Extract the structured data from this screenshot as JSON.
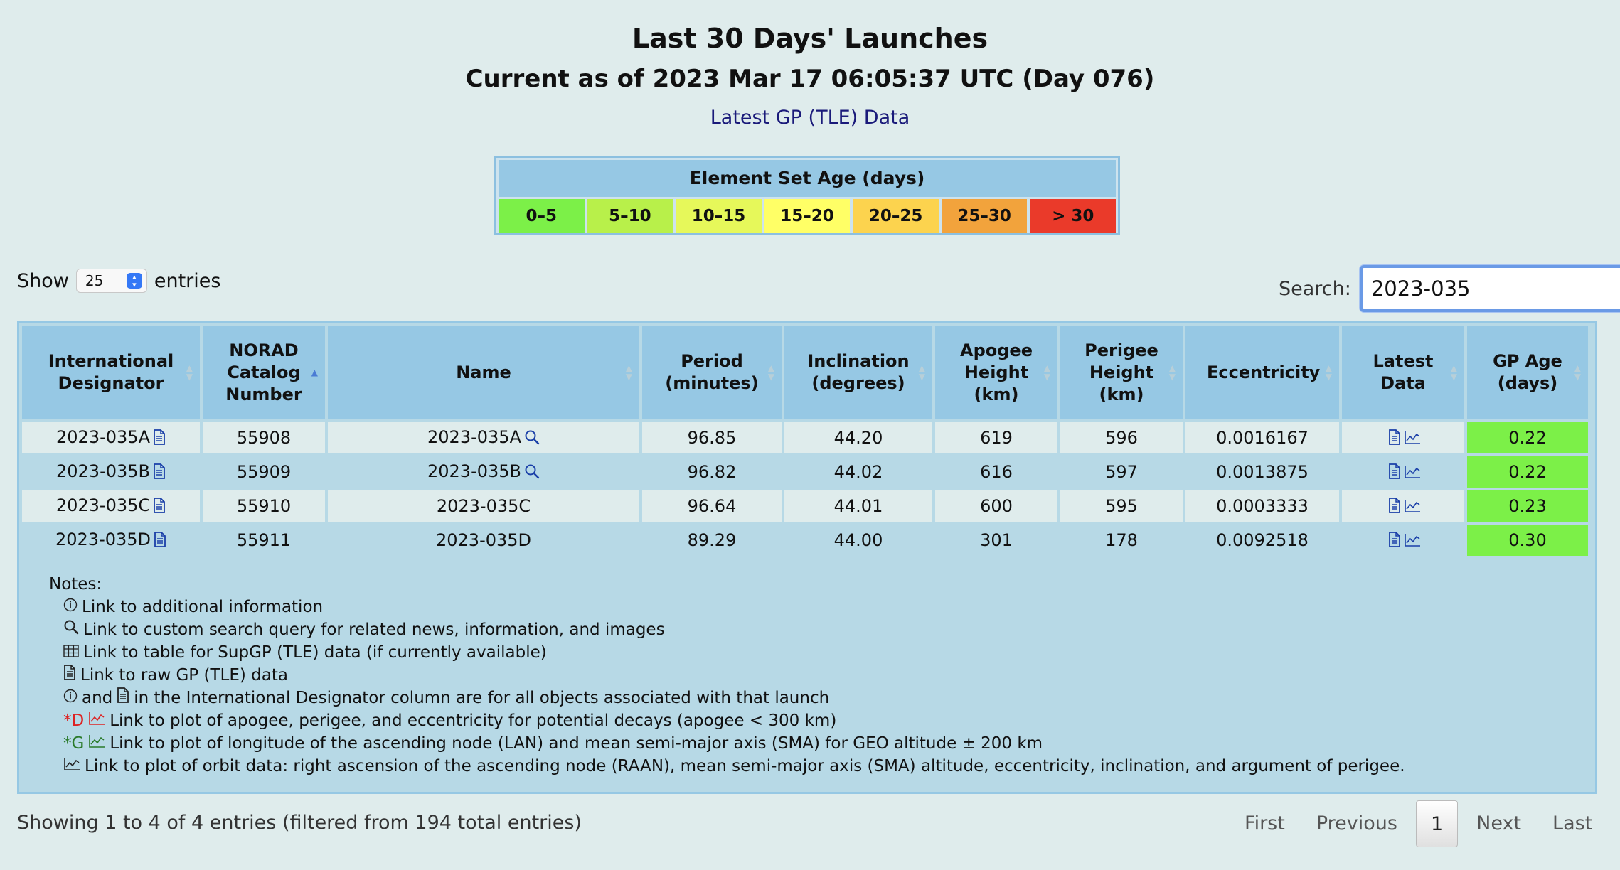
{
  "header": {
    "title": "Last 30 Days' Launches",
    "subtitle": "Current as of 2023 Mar 17 06:05:37 UTC (Day 076)",
    "gp_link": "Latest GP (TLE) Data"
  },
  "age_legend": {
    "title": "Element Set Age (days)",
    "buckets": [
      {
        "label": "0–5",
        "color": "#7cf048"
      },
      {
        "label": "5–10",
        "color": "#b8f04a"
      },
      {
        "label": "10–15",
        "color": "#e6f85a"
      },
      {
        "label": "15–20",
        "color": "#ffff66"
      },
      {
        "label": "20–25",
        "color": "#fcd34e"
      },
      {
        "label": "25–30",
        "color": "#f2a33c"
      },
      {
        "label": "> 30",
        "color": "#ea3a2a"
      }
    ]
  },
  "controls": {
    "show_label": "Show",
    "page_size": "25",
    "entries_label": "entries",
    "search_label": "Search:",
    "search_value": "2023-035"
  },
  "table": {
    "columns": [
      "International Designator",
      "NORAD Catalog Number",
      "Name",
      "Period (minutes)",
      "Inclination (degrees)",
      "Apogee Height (km)",
      "Perigee Height (km)",
      "Eccentricity",
      "Latest Data",
      "GP Age (days)"
    ],
    "rows": [
      {
        "intl": "2023-035A",
        "norad": "55908",
        "name": "2023-035A",
        "period": "96.85",
        "incl": "44.20",
        "apogee": "619",
        "perigee": "596",
        "ecc": "0.0016167",
        "age": "0.22"
      },
      {
        "intl": "2023-035B",
        "norad": "55909",
        "name": "2023-035B",
        "period": "96.82",
        "incl": "44.02",
        "apogee": "616",
        "perigee": "597",
        "ecc": "0.0013875",
        "age": "0.22"
      },
      {
        "intl": "2023-035C",
        "norad": "55910",
        "name": "2023-035C",
        "period": "96.64",
        "incl": "44.01",
        "apogee": "600",
        "perigee": "595",
        "ecc": "0.0003333",
        "age": "0.23"
      },
      {
        "intl": "2023-035D",
        "norad": "55911",
        "name": "2023-035D",
        "period": "89.29",
        "incl": "44.00",
        "apogee": "301",
        "perigee": "178",
        "ecc": "0.0092518",
        "age": "0.30"
      }
    ]
  },
  "notes": {
    "title": "Notes:",
    "items": [
      "Link to additional information",
      "Link to custom search query for related news, information, and images",
      "Link to table for SupGP (TLE) data (if currently available)",
      "Link to raw GP (TLE) data",
      "in the International Designator column are for all objects associated with that launch",
      "Link to plot of apogee, perigee, and eccentricity for potential decays (apogee < 300 km)",
      "Link to plot of longitude of the ascending node (LAN) and mean semi-major axis (SMA) for GEO altitude ± 200 km",
      "Link to plot of orbit data: right ascension of the ascending node (RAAN), mean semi-major axis (SMA) altitude, eccentricity, inclination, and argument of perigee."
    ],
    "and_word": "and",
    "decay_prefix": "*D",
    "geo_prefix": "*G"
  },
  "footer": {
    "info": "Showing 1 to 4 of 4 entries (filtered from 194 total entries)",
    "pager": {
      "first": "First",
      "previous": "Previous",
      "current": "1",
      "next": "Next",
      "last": "Last"
    }
  },
  "icons": [
    "document-icon",
    "magnifier-icon",
    "plot-icon",
    "info-icon",
    "table-icon",
    "clear-icon"
  ]
}
